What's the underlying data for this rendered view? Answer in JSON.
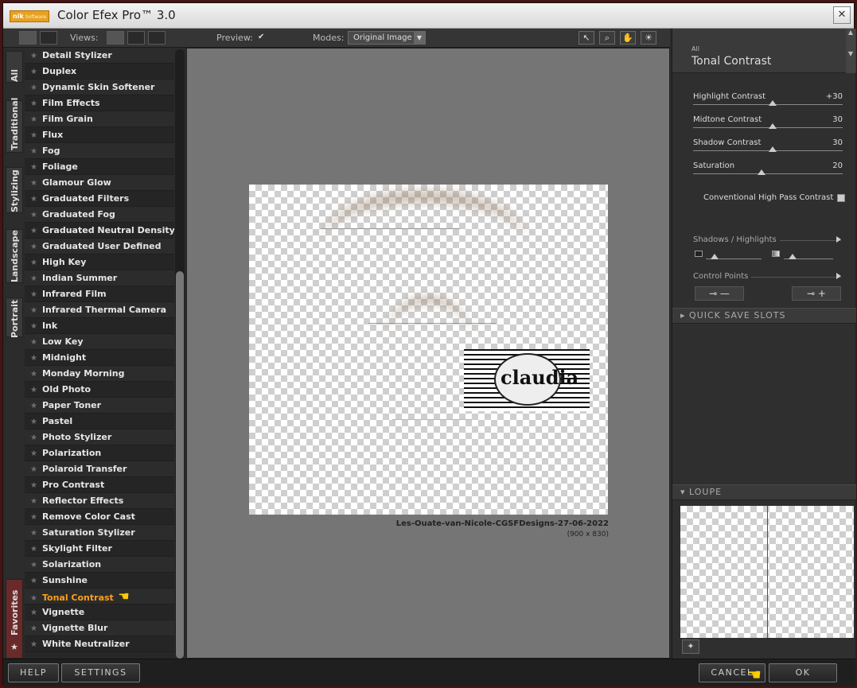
{
  "window": {
    "title": "Color Efex Pro™ 3.0",
    "logo_text": "nik",
    "logo_sub": "Software",
    "close_glyph": "✕"
  },
  "toolbar": {
    "views_label": "Views:",
    "preview_label": "Preview:",
    "preview_checked": true,
    "modes_label": "Modes:",
    "mode_value": "Original Image"
  },
  "tabs": [
    "All",
    "Traditional",
    "Stylizing",
    "Landscape",
    "Portrait",
    "Favorites"
  ],
  "filters": [
    "Detail Stylizer",
    "Duplex",
    "Dynamic Skin Softener",
    "Film Effects",
    "Film Grain",
    "Flux",
    "Fog",
    "Foliage",
    "Glamour Glow",
    "Graduated Filters",
    "Graduated Fog",
    "Graduated Neutral Density",
    "Graduated User Defined",
    "High Key",
    "Indian Summer",
    "Infrared Film",
    "Infrared Thermal Camera",
    "Ink",
    "Low Key",
    "Midnight",
    "Monday Morning",
    "Old Photo",
    "Paper Toner",
    "Pastel",
    "Photo Stylizer",
    "Polarization",
    "Polaroid Transfer",
    "Pro Contrast",
    "Reflector Effects",
    "Remove Color Cast",
    "Saturation Stylizer",
    "Skylight Filter",
    "Solarization",
    "Sunshine",
    "Tonal Contrast",
    "Vignette",
    "Vignette Blur",
    "White Neutralizer"
  ],
  "selected_filter": "Tonal Contrast",
  "image": {
    "name": "Les-Ouate-van-Nicole-CGSFDesigns-27-06-2022",
    "size": "(900 x 830)",
    "watermark_text": "claudia"
  },
  "panel": {
    "category": "All",
    "title": "Tonal Contrast",
    "sliders": [
      {
        "label": "Highlight Contrast",
        "value": "+30",
        "level": 0.53
      },
      {
        "label": "Midtone Contrast",
        "value": "30",
        "level": 0.53
      },
      {
        "label": "Shadow Contrast",
        "value": "30",
        "level": 0.53
      },
      {
        "label": "Saturation",
        "value": "20",
        "level": 0.46
      }
    ],
    "checkbox_label": "Conventional High Pass Contrast",
    "shadows_highlights_label": "Shadows / Highlights",
    "control_points_label": "Control Points",
    "quick_save_label": "QUICK SAVE SLOTS",
    "loupe_label": "LOUPE"
  },
  "buttons": {
    "help": "HELP",
    "settings": "SETTINGS",
    "cancel": "CANCEL",
    "ok": "OK"
  }
}
